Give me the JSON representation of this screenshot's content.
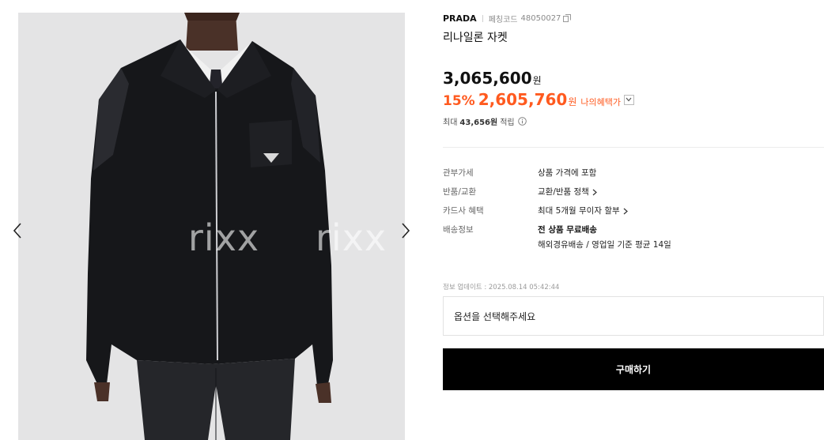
{
  "gallery": {
    "watermark_1": "rixx",
    "watermark_2": "rixx",
    "prev_icon": "chevron-left-icon",
    "next_icon": "chevron-right-icon"
  },
  "product": {
    "brand": "PRADA",
    "code_label": "페칭코드",
    "code_value": "48050027",
    "title": "리나일론 자켓",
    "price": "3,065,600",
    "price_unit": "원",
    "discount_percent": "15%",
    "sale_price": "2,605,760",
    "sale_unit": "원",
    "benefit_label": "나의혜택가",
    "points_prefix": "최대",
    "points_value": "43,656원",
    "points_suffix": "적립"
  },
  "details": {
    "rows": [
      {
        "label": "관부가세",
        "value": "상품 가격에 포함"
      },
      {
        "label": "반품/교환",
        "value": "교환/반품 정책"
      },
      {
        "label": "카드사 혜택",
        "value": "최대 5개월 무이자 할부"
      },
      {
        "label": "배송정보",
        "value": "전 상품 무료배송",
        "sub": "해외경유배송 / 영업일 기준 평균 14일"
      }
    ]
  },
  "updated": "정보 업데이트 : 2025.08.14 05:42:44",
  "option_placeholder": "옵션을 선택해주세요",
  "buy_label": "구매하기",
  "colors": {
    "accent": "#ff5a1f",
    "button_bg": "#000000",
    "gallery_bg": "#e4e4e5"
  }
}
